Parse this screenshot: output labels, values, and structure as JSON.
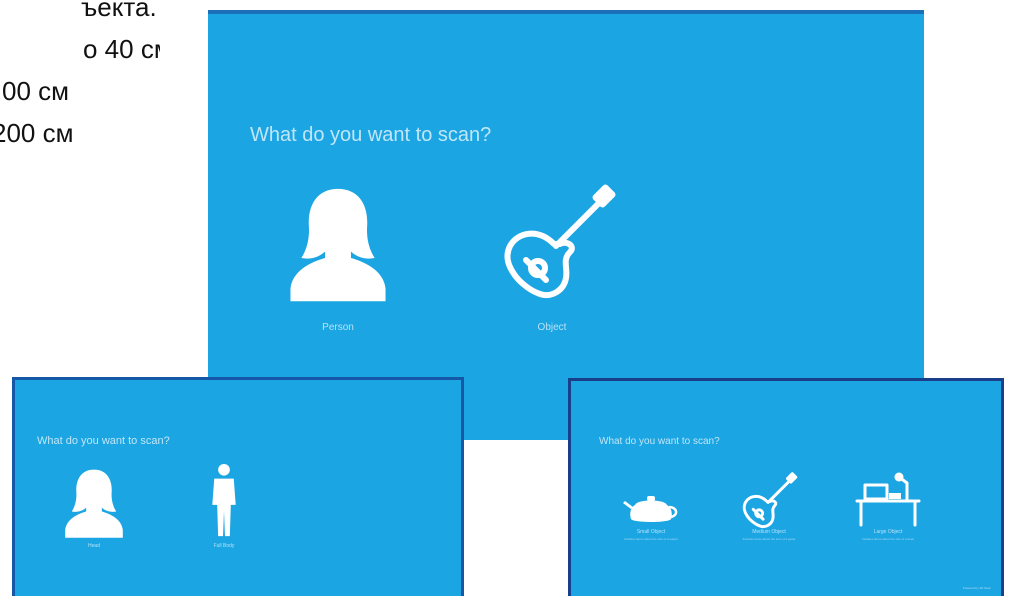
{
  "russian_text": {
    "lines": [
      "ъекта.",
      "о 40 см",
      "00 см",
      "200 см"
    ]
  },
  "big_screen": {
    "title": "What do you want to scan?",
    "options": [
      {
        "label": "Person",
        "icon": "person-icon"
      },
      {
        "label": "Object",
        "icon": "guitar-icon"
      }
    ]
  },
  "small_left_screen": {
    "title": "What do you want to scan?",
    "options": [
      {
        "label": "Head",
        "icon": "person-icon"
      },
      {
        "label": "Full Body",
        "icon": "full-body-icon"
      }
    ]
  },
  "small_right_screen": {
    "title": "What do you want to scan?",
    "options": [
      {
        "label": "Small Object",
        "sublabel": "Includes items about the size of a teapot",
        "icon": "teapot-icon"
      },
      {
        "label": "Medium Object",
        "sublabel": "Includes items about the size of a guitar",
        "icon": "guitar-icon"
      },
      {
        "label": "Large Object",
        "sublabel": "Includes items about the size of a desk",
        "icon": "desk-icon"
      }
    ],
    "corner_note": "Powered by 3D Scan"
  },
  "colors": {
    "screen_bg": "#1ca5e3",
    "icon": "#ffffff"
  }
}
